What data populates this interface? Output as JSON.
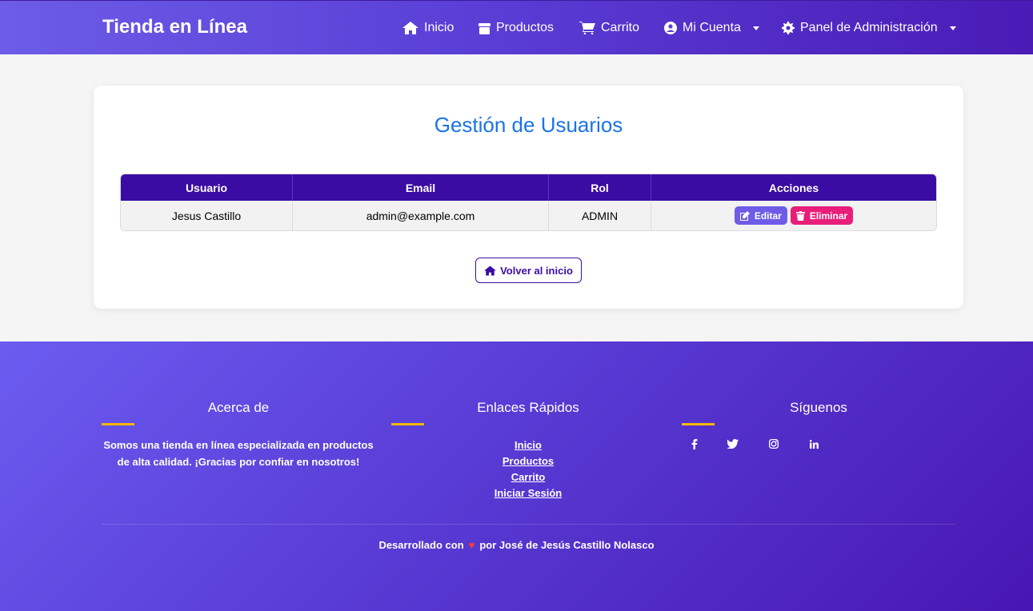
{
  "navbar": {
    "brand": "Tienda en Línea",
    "items": [
      {
        "label": "Inicio",
        "icon": "home-icon"
      },
      {
        "label": "Productos",
        "icon": "box-icon"
      },
      {
        "label": "Carrito",
        "icon": "cart-icon"
      },
      {
        "label": "Mi Cuenta",
        "icon": "user-circle-icon",
        "dropdown": true
      },
      {
        "label": "Panel de Administración",
        "icon": "gear-icon",
        "dropdown": true
      }
    ]
  },
  "main": {
    "title": "Gestión de Usuarios",
    "table": {
      "headers": [
        "Usuario",
        "Email",
        "Rol",
        "Acciones"
      ],
      "rows": [
        {
          "usuario": "Jesus Castillo",
          "email": "admin@example.com",
          "rol": "ADMIN"
        }
      ],
      "actions": {
        "edit": "Editar",
        "delete": "Eliminar"
      }
    },
    "back_button": "Volver al inicio"
  },
  "footer": {
    "about": {
      "title": "Acerca de",
      "text": "Somos una tienda en línea especializada en productos de alta calidad. ¡Gracias por confiar en nosotros!"
    },
    "quick_links": {
      "title": "Enlaces Rápidos",
      "links": [
        "Inicio",
        "Productos",
        "Carrito",
        "Iniciar Sesión"
      ]
    },
    "follow": {
      "title": "Síguenos",
      "icons": [
        "facebook-icon",
        "twitter-icon",
        "instagram-icon",
        "linkedin-icon"
      ]
    },
    "credits": {
      "prefix": "Desarrollado con",
      "suffix": "por José de Jesús Castillo Nolasco"
    }
  },
  "colors": {
    "accent": "#6c5ce7",
    "header_dark": "#3b0ca3",
    "title_blue": "#1a73e8",
    "delete_pink": "#e91e7a",
    "underline_gold": "#f5b800"
  }
}
